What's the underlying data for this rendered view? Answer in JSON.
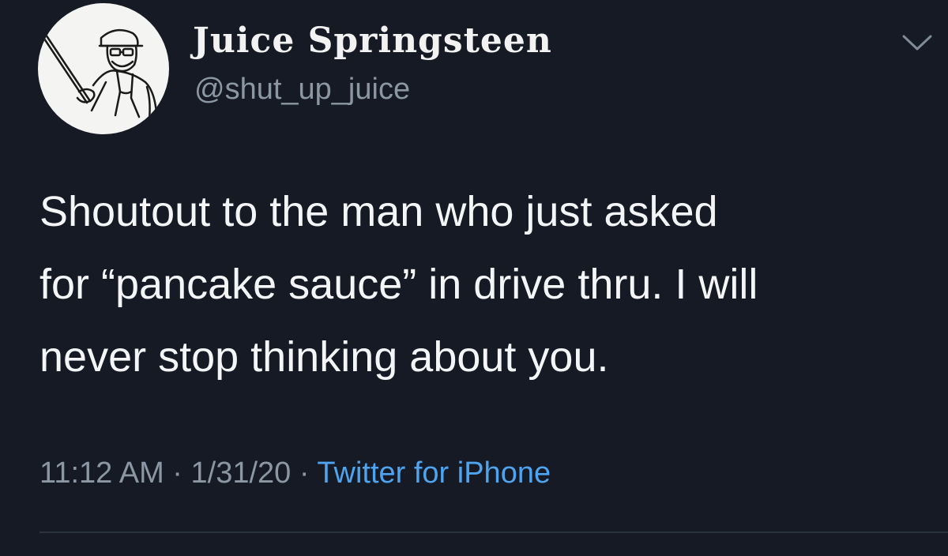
{
  "tweet": {
    "author": {
      "display_name": "Juice Springsteen",
      "handle": "@shut_up_juice",
      "avatar": "avatar-illustration"
    },
    "menu_icon": "chevron-down-icon",
    "text": "Shoutout to the man who just asked\nfor “pancake sauce” in drive thru. I will\nnever stop thinking about you.",
    "time": "11:12 AM",
    "separator": "·",
    "date": "1/31/20",
    "source": "Twitter for iPhone"
  },
  "colors": {
    "background": "#151a24",
    "primary_text": "#f4f5f6",
    "secondary_text": "#8b97a3",
    "link": "#4ea4ee",
    "divider": "#2a323c"
  }
}
